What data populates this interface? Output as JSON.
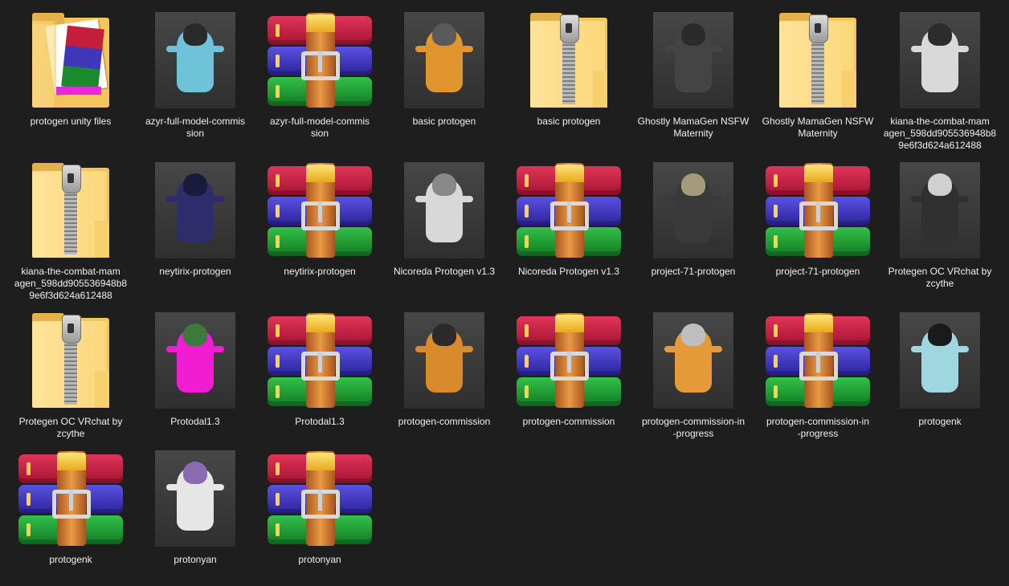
{
  "files": [
    {
      "label": "protogen unity files",
      "type": "files-folder"
    },
    {
      "label": "azyr-full-model-commis\nsion",
      "type": "model",
      "colors": [
        "#6fc3d9",
        "#2a2a2a"
      ]
    },
    {
      "label": "azyr-full-model-commis\nsion",
      "type": "rar"
    },
    {
      "label": "basic protogen",
      "type": "model",
      "colors": [
        "#e0952f",
        "#5a5a5a"
      ]
    },
    {
      "label": "basic protogen",
      "type": "zip-folder"
    },
    {
      "label": "Ghostly MamaGen NSFW\nMaternity",
      "type": "model",
      "colors": [
        "#444444",
        "#2b2b2b"
      ]
    },
    {
      "label": "Ghostly MamaGen NSFW\nMaternity",
      "type": "zip-folder"
    },
    {
      "label": "kiana-the-combat-mam\nagen_598dd905536948b8\n9e6f3d624a612488",
      "type": "model",
      "colors": [
        "#d9d9d9",
        "#2c2c2c"
      ]
    },
    {
      "label": "kiana-the-combat-mam\nagen_598dd905536948b8\n9e6f3d624a612488",
      "type": "zip-folder"
    },
    {
      "label": "neytirix-protogen",
      "type": "model",
      "colors": [
        "#2e2c6b",
        "#1a1a3d"
      ]
    },
    {
      "label": "neytirix-protogen",
      "type": "rar"
    },
    {
      "label": "Nicoreda Protogen v1.3",
      "type": "model",
      "colors": [
        "#d8d8d8",
        "#888888"
      ]
    },
    {
      "label": "Nicoreda Protogen v1.3",
      "type": "rar"
    },
    {
      "label": "project-71-protogen",
      "type": "model",
      "colors": [
        "#3a3a3a",
        "#a69a7c"
      ]
    },
    {
      "label": "project-71-protogen",
      "type": "rar"
    },
    {
      "label": "Protegen OC VRchat by\nzcythe",
      "type": "model",
      "colors": [
        "#303030",
        "#d0d0d0"
      ]
    },
    {
      "label": "Protegen OC VRchat by\nzcythe",
      "type": "zip-folder"
    },
    {
      "label": "Protodal1.3",
      "type": "model",
      "colors": [
        "#f21cd3",
        "#3c7a3c"
      ]
    },
    {
      "label": "Protodal1.3",
      "type": "rar"
    },
    {
      "label": "protogen-commission",
      "type": "model",
      "colors": [
        "#d88a2c",
        "#2a2a2a"
      ]
    },
    {
      "label": "protogen-commission",
      "type": "rar"
    },
    {
      "label": "protogen-commission-in\n-progress",
      "type": "model",
      "colors": [
        "#e59a3a",
        "#bfbfbf"
      ]
    },
    {
      "label": "protogen-commission-in\n-progress",
      "type": "rar"
    },
    {
      "label": "protogenk",
      "type": "model",
      "colors": [
        "#9fd7e0",
        "#1a1a1a"
      ]
    },
    {
      "label": "protogenk",
      "type": "rar"
    },
    {
      "label": "protonyan",
      "type": "model",
      "colors": [
        "#e6e6e6",
        "#8a6ab0"
      ]
    },
    {
      "label": "protonyan",
      "type": "rar"
    }
  ]
}
